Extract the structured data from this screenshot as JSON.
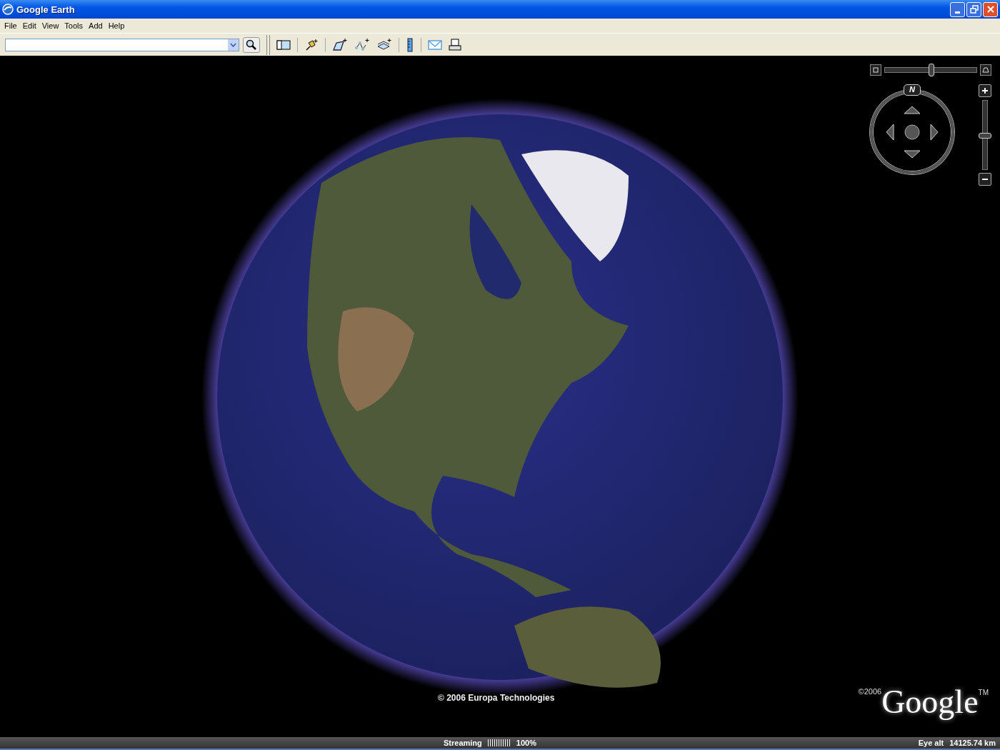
{
  "window": {
    "title": "Google Earth"
  },
  "menu": [
    "File",
    "Edit",
    "View",
    "Tools",
    "Add",
    "Help"
  ],
  "viewport": {
    "copyright": "© 2006 Europa Technologies",
    "logo": {
      "prefix": "©2006",
      "text": "Google",
      "suffix": "TM"
    },
    "navigation": {
      "north": "N",
      "tilt": {
        "level": 0.5
      },
      "zoom": {
        "level": 0.5
      }
    }
  },
  "status_bar": {
    "label": "Streaming",
    "progress": {
      "level": 1
    },
    "percent": "100%",
    "eye_alt_label": "Eye alt",
    "eye_alt": "14125.74 km"
  }
}
